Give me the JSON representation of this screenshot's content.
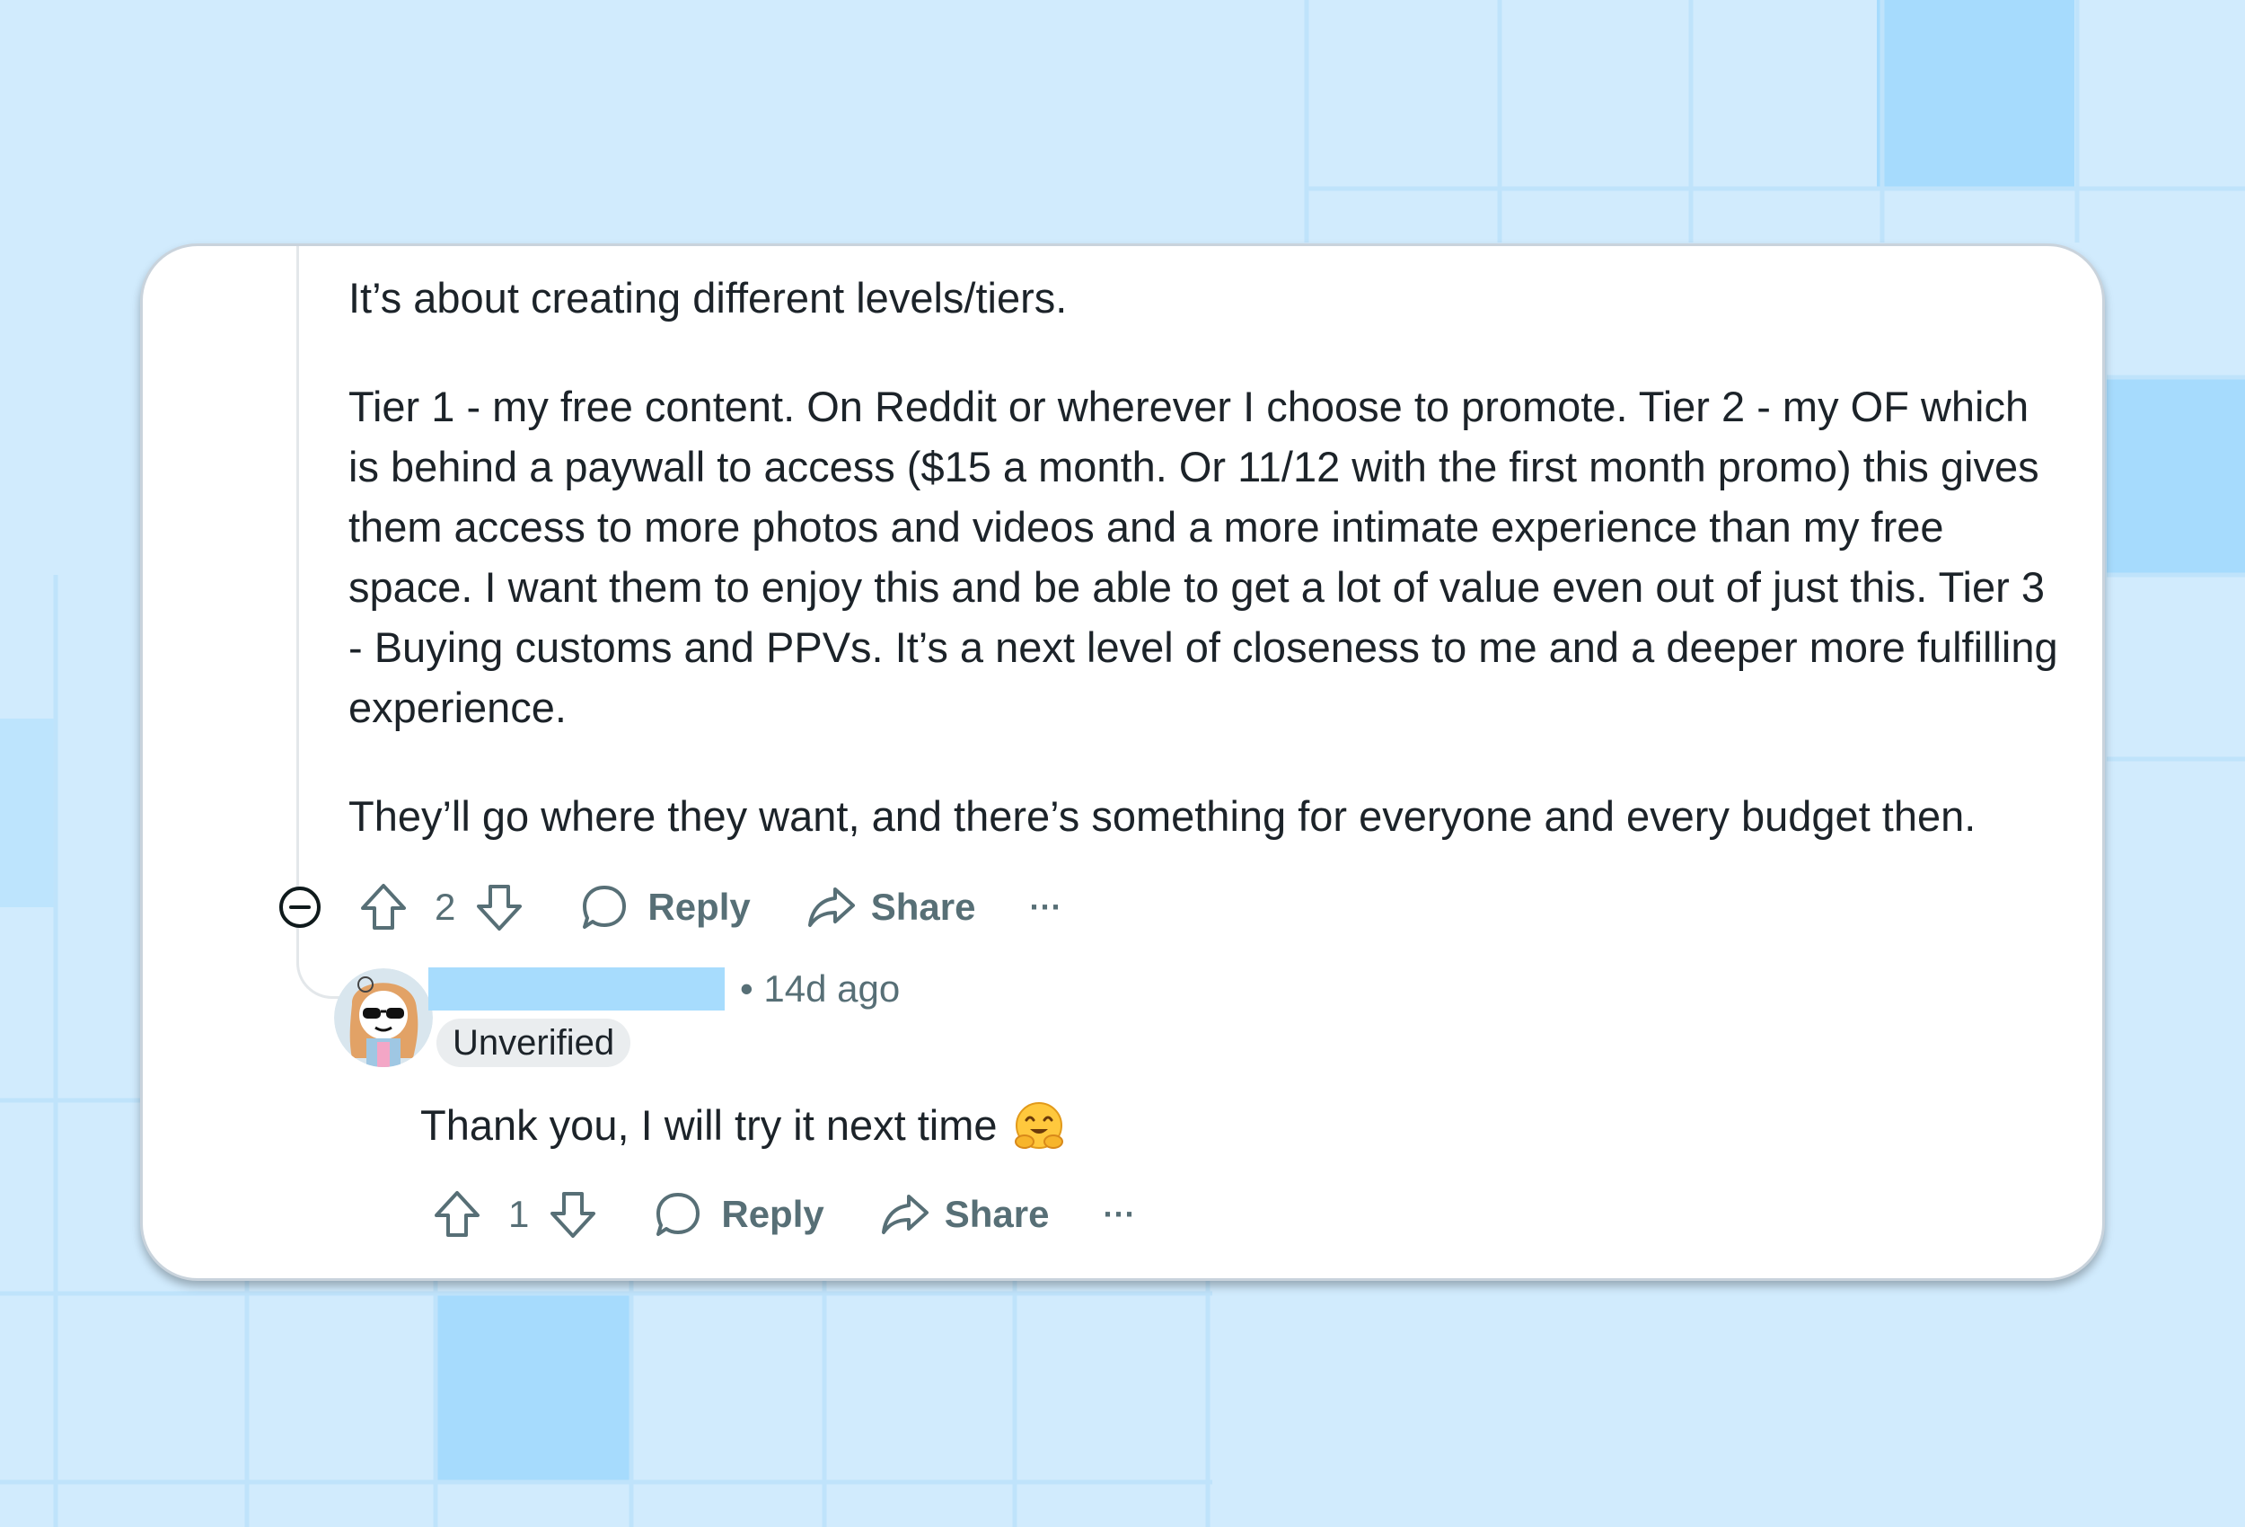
{
  "parent_comment": {
    "paragraphs": [
      "It’s about creating different levels/tiers.",
      "Tier 1 - my free content. On Reddit or wherever I choose to promote. Tier 2 - my OF which is behind a paywall to access ($15 a month. Or 11/12 with the first month promo) this gives them access to more photos and videos and a more intimate experience than my free space. I want them to enjoy this and be able to get a lot of value even out of just this. Tier 3 - Buying customs and PPVs. It’s a next level of closeness to me and a deeper more fulfilling experience.",
      "They’ll go where they want, and there’s something for everyone and every budget then."
    ],
    "actions": {
      "score": "2",
      "reply_label": "Reply",
      "share_label": "Share",
      "more_label": "···"
    }
  },
  "reply_comment": {
    "meta": "• 14d ago",
    "badge": "Unverified",
    "text": "Thank you, I will try it next time",
    "emoji": "hugging-face",
    "actions": {
      "score": "1",
      "reply_label": "Reply",
      "share_label": "Share",
      "more_label": "···"
    }
  },
  "colors": {
    "background": "#d1ebfd",
    "grid_line": "#bfe3fb",
    "highlight_tile": "#a6dbfd",
    "card": "#ffffff",
    "body_text": "#1c2329",
    "secondary_text": "#576f76",
    "redaction": "#a7dcfd"
  }
}
